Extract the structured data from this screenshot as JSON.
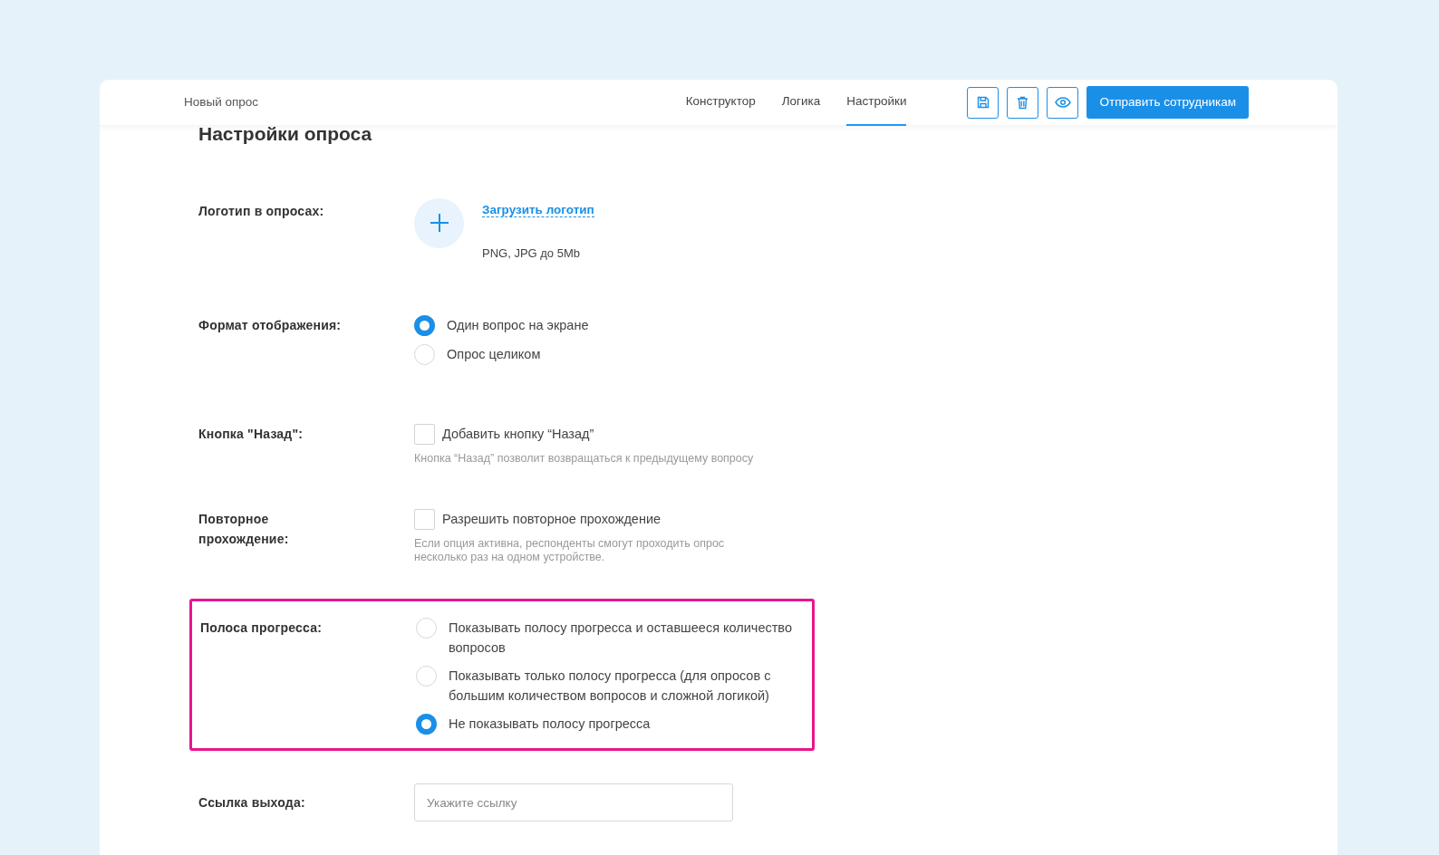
{
  "header": {
    "title": "Новый опрос",
    "tabs": [
      {
        "label": "Конструктор",
        "selected": false
      },
      {
        "label": "Логика",
        "selected": false
      },
      {
        "label": "Настройки",
        "selected": true
      }
    ],
    "primary_button": "Отправить сотрудникам"
  },
  "page_title": "Настройки опроса",
  "settings": [
    {
      "kind": "upload",
      "label": "Логотип в опросах:",
      "link": "Загрузить логотип",
      "hint": "PNG, JPG до 5Mb",
      "highlighted": false
    },
    {
      "kind": "radio",
      "label": "Формат отображения:",
      "highlighted": false,
      "options": [
        {
          "label": "Один вопрос на экране",
          "selected": true
        },
        {
          "label": "Опрос целиком",
          "selected": false
        }
      ]
    },
    {
      "kind": "checkbox",
      "label": "Кнопка \"Назад\":",
      "option": "Добавить кнопку “Назад”",
      "checked": false,
      "hint": "Кнопка “Назад” позволит возвращаться к предыдущему вопросу",
      "highlighted": false
    },
    {
      "kind": "checkbox",
      "label": "Повторное прохождение:",
      "option": "Разрешить повторное прохождение",
      "checked": false,
      "hint": "Если опция активна, респонденты смогут проходить опрос несколько раз на одном устройстве.",
      "highlighted": false
    },
    {
      "kind": "radio",
      "label": "Полоса прогресса:",
      "highlighted": true,
      "options": [
        {
          "label": "Показывать полосу прогресса и оставшееся количество вопросов",
          "selected": false
        },
        {
          "label": "Показывать только полосу прогресса (для опросов с большим количеством вопросов и сложной логикой)",
          "selected": false
        },
        {
          "label": "Не показывать полосу прогресса",
          "selected": true
        }
      ]
    },
    {
      "kind": "input",
      "label": "Ссылка выхода:",
      "placeholder": "Укажите ссылку",
      "highlighted": false
    }
  ]
}
